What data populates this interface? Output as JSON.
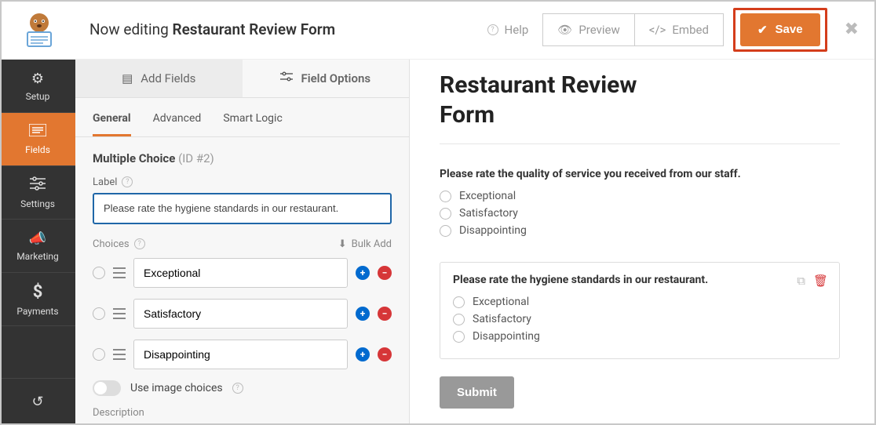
{
  "header": {
    "prefix": "Now editing",
    "form_name": "Restaurant Review Form",
    "help": "Help",
    "preview": "Preview",
    "embed": "Embed",
    "save": "Save"
  },
  "rail": {
    "setup": "Setup",
    "fields": "Fields",
    "settings": "Settings",
    "marketing": "Marketing",
    "payments": "Payments"
  },
  "panel": {
    "add_fields": "Add Fields",
    "field_options": "Field Options",
    "tab_general": "General",
    "tab_advanced": "Advanced",
    "tab_smart": "Smart Logic",
    "field_type": "Multiple Choice",
    "field_id": "(ID #2)",
    "label_title": "Label",
    "label_value": "Please rate the hygiene standards in our restaurant.",
    "choices_title": "Choices",
    "bulk_add": "Bulk Add",
    "choice1": "Exceptional",
    "choice2": "Satisfactory",
    "choice3": "Disappointing",
    "image_choices": "Use image choices",
    "description": "Description"
  },
  "preview": {
    "title": "Restaurant Review Form",
    "q1": {
      "label": "Please rate the quality of service you received from our staff.",
      "o1": "Exceptional",
      "o2": "Satisfactory",
      "o3": "Disappointing"
    },
    "q2": {
      "label": "Please rate the hygiene standards in our restaurant.",
      "o1": "Exceptional",
      "o2": "Satisfactory",
      "o3": "Disappointing"
    },
    "submit": "Submit"
  }
}
